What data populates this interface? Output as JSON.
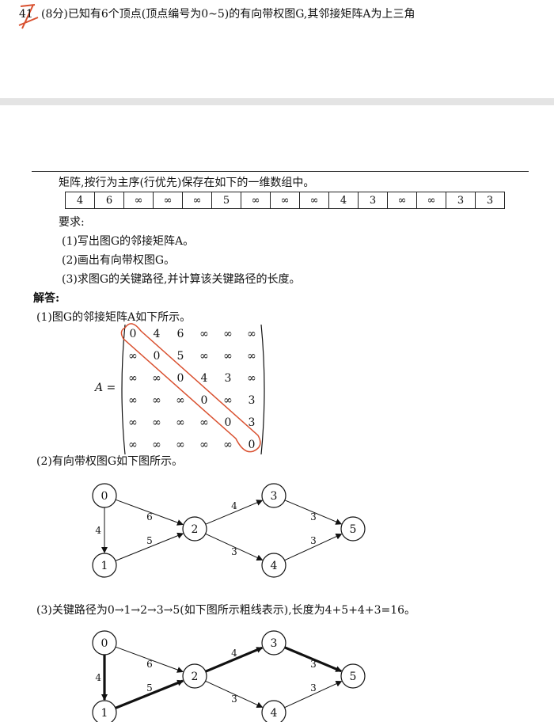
{
  "question": {
    "number": "41",
    "text": "(8分)已知有6个顶点(顶点编号为0~5)的有向带权图G,其邻接矩阵A为上三角",
    "continuation": "矩阵,按行为主序(行优先)保存在如下的一维数组中。",
    "array": [
      "4",
      "6",
      "∞",
      "∞",
      "∞",
      "5",
      "∞",
      "∞",
      "∞",
      "4",
      "3",
      "∞",
      "∞",
      "3",
      "3"
    ],
    "requirements_label": "要求:",
    "requirements": [
      "(1)写出图G的邻接矩阵A。",
      "(2)画出有向带权图G。",
      "(3)求图G的关键路径,并计算该关键路径的长度。"
    ]
  },
  "answer": {
    "label": "解答:",
    "part1": "(1)图G的邻接矩阵A如下所示。",
    "matrix_label": "A =",
    "matrix": [
      [
        "0",
        "4",
        "6",
        "∞",
        "∞",
        "∞"
      ],
      [
        "∞",
        "0",
        "5",
        "∞",
        "∞",
        "∞"
      ],
      [
        "∞",
        "∞",
        "0",
        "4",
        "3",
        "∞"
      ],
      [
        "∞",
        "∞",
        "∞",
        "0",
        "∞",
        "3"
      ],
      [
        "∞",
        "∞",
        "∞",
        "∞",
        "0",
        "3"
      ],
      [
        "∞",
        "∞",
        "∞",
        "∞",
        "∞",
        "0"
      ]
    ],
    "part2": "(2)有向带权图G如下图所示。",
    "part3": "(3)关键路径为0→1→2→3→5(如下图所示粗线表示),长度为4+5+4+3=16。"
  },
  "graph": {
    "nodes": [
      "0",
      "1",
      "2",
      "3",
      "4",
      "5"
    ],
    "edges": [
      {
        "from": "0",
        "to": "1",
        "weight": "4",
        "critical": true
      },
      {
        "from": "0",
        "to": "2",
        "weight": "6",
        "critical": false
      },
      {
        "from": "1",
        "to": "2",
        "weight": "5",
        "critical": true
      },
      {
        "from": "2",
        "to": "3",
        "weight": "4",
        "critical": true
      },
      {
        "from": "2",
        "to": "4",
        "weight": "3",
        "critical": false
      },
      {
        "from": "3",
        "to": "5",
        "weight": "3",
        "critical": true
      },
      {
        "from": "4",
        "to": "5",
        "weight": "3",
        "critical": false
      }
    ]
  },
  "colors": {
    "annotation": "#d9502f",
    "ink": "#111111",
    "band": "#e4e4e4"
  }
}
